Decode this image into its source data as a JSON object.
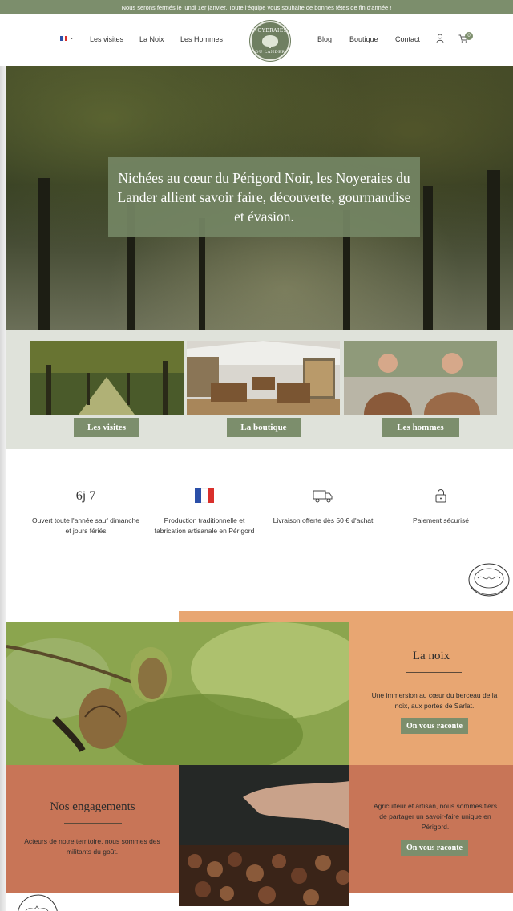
{
  "announcement": "Nous serons fermés le lundi 1er janvier. Toute l'équipe vous souhaite de bonnes fêtes de fin d'année !",
  "nav": {
    "language_icon": "french-flag-icon",
    "left": [
      "Les visites",
      "La Noix",
      "Les Hommes"
    ],
    "right": [
      "Blog",
      "Boutique",
      "Contact"
    ],
    "logo_top": "NOYERAIES",
    "logo_bottom": "DU LANDER",
    "cart_count": "0"
  },
  "hero": {
    "headline": "Nichées au cœur du Périgord Noir, les Noyeraies du Lander allient savoir faire, découverte, gourmandise et évasion."
  },
  "tiles": [
    {
      "label": "Les visites"
    },
    {
      "label": "La boutique"
    },
    {
      "label": "Les hommes"
    }
  ],
  "features": [
    {
      "top": "6j 7",
      "text": "Ouvert toute l'année sauf dimanche et jours fériés"
    },
    {
      "icon": "french-flag-icon",
      "text": "Production traditionnelle et fabrication artisanale en Périgord"
    },
    {
      "icon": "delivery-truck-icon",
      "text": "Livraison offerte dès 50 € d'achat"
    },
    {
      "icon": "padlock-icon",
      "text": "Paiement sécurisé"
    }
  ],
  "noix": {
    "title": "La noix",
    "text": "Une immersion au cœur du berceau de la noix, aux portes de Sarlat.",
    "cta": "On vous raconte"
  },
  "engagements": {
    "title": "Nos engagements",
    "text": "Acteurs de notre territoire, nous sommes des militants du goût."
  },
  "agriculteur": {
    "text": "Agriculteur et artisan, nous sommes fiers de partager un savoir-faire unique en Périgord.",
    "cta": "On vous raconte"
  },
  "colors": {
    "sage": "#7c8e6c",
    "peach": "#e8a672",
    "rust": "#c87557",
    "band": "#dfe2da"
  }
}
